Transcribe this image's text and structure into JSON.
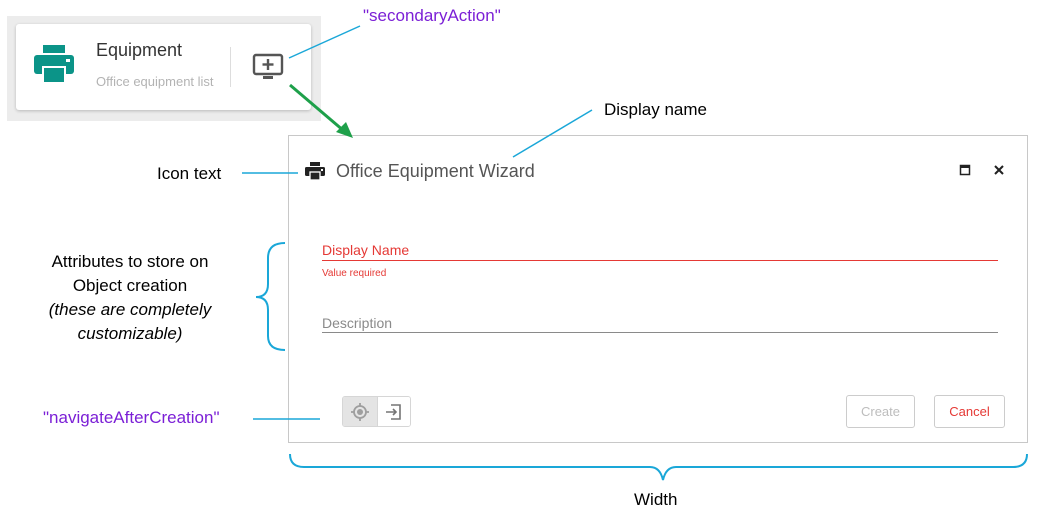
{
  "tile": {
    "title": "Equipment",
    "subtitle": "Office equipment list",
    "icon": "printer-icon",
    "action_icon": "monitor-add-icon"
  },
  "dialog": {
    "title": "Office Equipment Wizard",
    "icon": "printer-icon",
    "fields": [
      {
        "label": "Display Name",
        "helper": "Value required",
        "state": "error"
      },
      {
        "label": "Description",
        "state": "normal"
      }
    ],
    "navigate_options": [
      "locate-icon",
      "enter-icon"
    ],
    "buttons": {
      "create": "Create",
      "cancel": "Cancel"
    }
  },
  "annotations": {
    "secondary_action": "\"secondaryAction\"",
    "display_name": "Display name",
    "icon_text": "Icon text",
    "attributes_line1": "Attributes to store on",
    "attributes_line2": "Object creation",
    "attributes_line3": "(these are completely",
    "attributes_line4": "customizable)",
    "navigate": "\"navigateAfterCreation\"",
    "width": "Width"
  },
  "colors": {
    "tile_icon": "#0b9488",
    "error": "#e53935",
    "annotation_line": "#1aa7d8",
    "flow_arrow": "#1ea04a",
    "annotation_code": "#7b1fd6"
  }
}
